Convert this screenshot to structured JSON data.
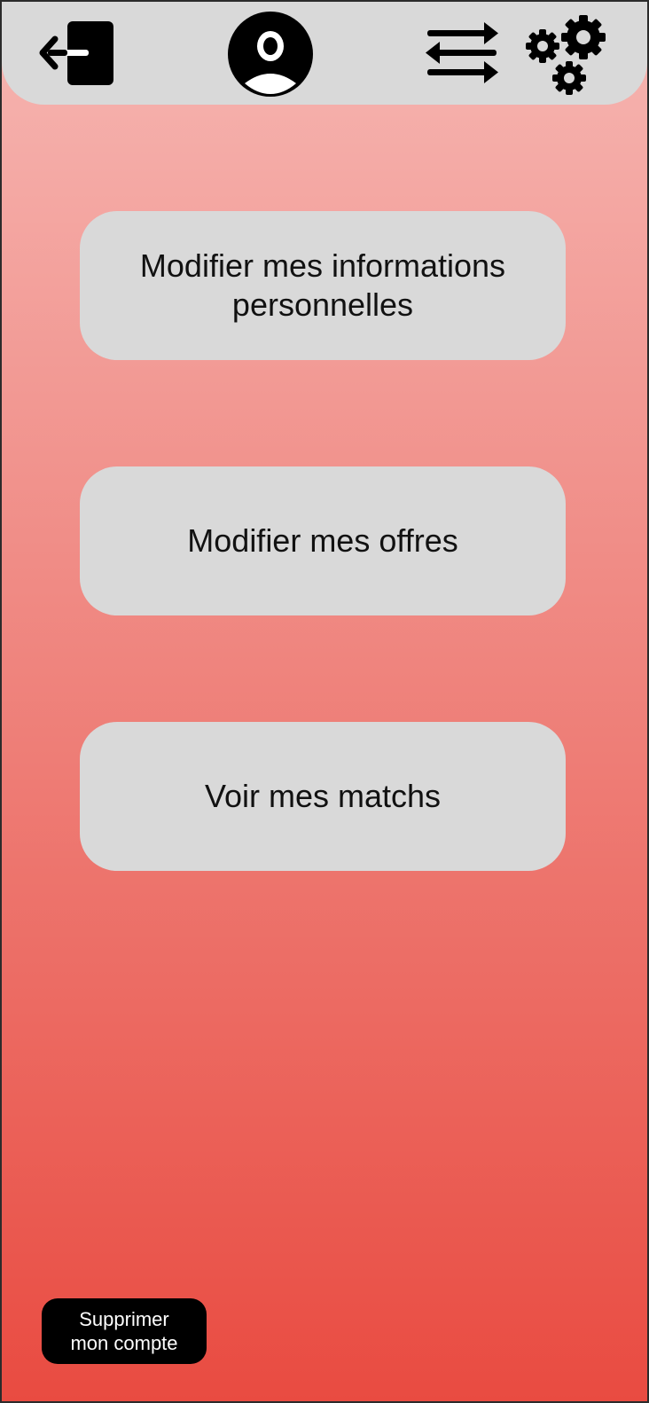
{
  "colors": {
    "topbar": "#d9d9d9",
    "button_bg": "#d9d9d9",
    "gradient_top": "#f6b6b2",
    "gradient_bottom": "#e94b41",
    "delete_bg": "#000000",
    "delete_text": "#ffffff"
  },
  "header": {
    "icons": {
      "logout": "logout-icon",
      "profile": "user-avatar-icon",
      "swap": "swap-arrows-icon",
      "settings": "gears-icon"
    }
  },
  "menu": {
    "edit_info_label": "Modifier mes informations personnelles",
    "edit_offers_label": "Modifier mes offres",
    "view_matches_label": "Voir mes matchs"
  },
  "footer": {
    "delete_account_label": "Supprimer mon compte"
  }
}
